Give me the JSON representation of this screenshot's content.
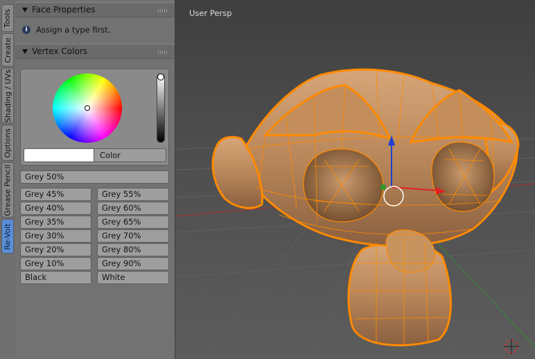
{
  "tabs": [
    "Tools",
    "Create",
    "Shading / UVs",
    "Options",
    "Grease Pencil",
    "Re-Volt"
  ],
  "active_tab": "Re-Volt",
  "face_properties": {
    "title": "Face Properties",
    "info_text": "Assign a type first."
  },
  "vertex_colors": {
    "title": "Vertex Colors",
    "color_field_label": "Color",
    "swatch_color": "#ffffff",
    "grey50": "Grey 50%",
    "left_column": [
      "Grey 45%",
      "Grey 40%",
      "Grey 35%",
      "Grey 30%",
      "Grey 20%",
      "Grey 10%",
      "Black"
    ],
    "right_column": [
      "Grey 55%",
      "Grey 60%",
      "Grey 65%",
      "Grey 70%",
      "Grey 80%",
      "Grey 90%",
      "White"
    ]
  },
  "viewport": {
    "label": "User Persp",
    "mesh_color": "#ff8a00",
    "axis_colors": {
      "x": "#e02020",
      "y": "#2d9a2d",
      "z": "#2040d0"
    }
  },
  "icons": [
    "info-icon",
    "panel-grip-icon",
    "collapse-triangle-icon",
    "3d-cursor-icon",
    "transform-gizmo-icon"
  ]
}
